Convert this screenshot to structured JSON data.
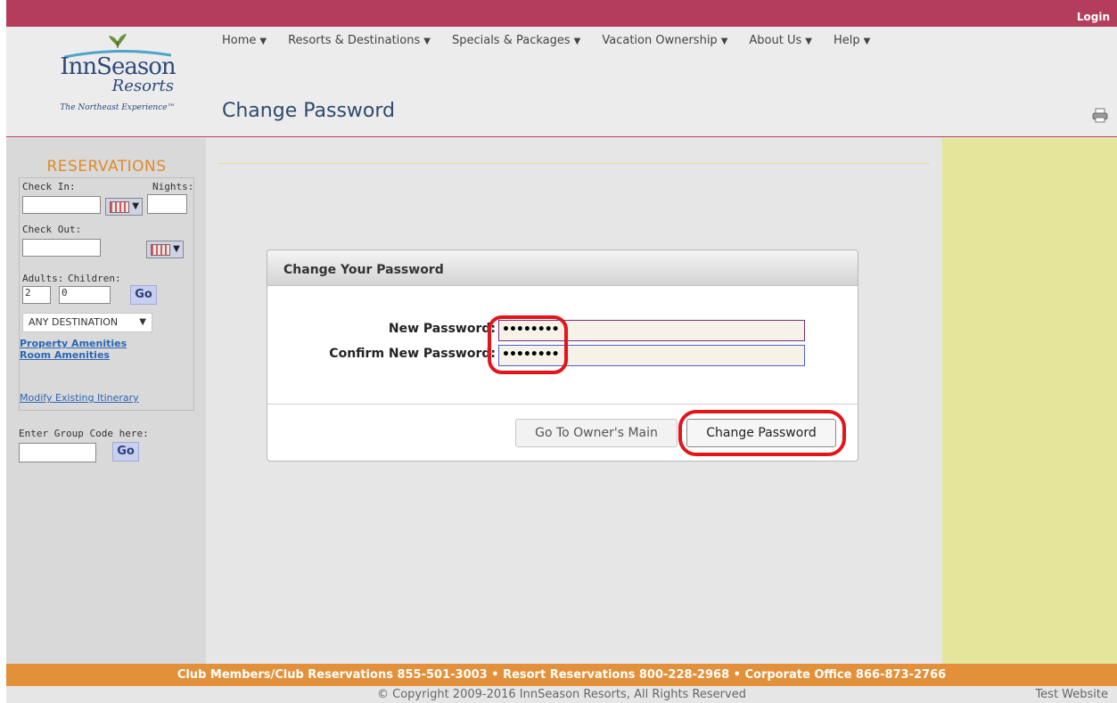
{
  "topbar": {
    "login_label": "Login"
  },
  "logo": {
    "name": "InnSeason",
    "sub": "Resorts",
    "tagline": "The Northeast Experience™"
  },
  "nav": [
    {
      "label": "Home"
    },
    {
      "label": "Resorts & Destinations"
    },
    {
      "label": "Specials & Packages"
    },
    {
      "label": "Vacation Ownership"
    },
    {
      "label": "About Us"
    },
    {
      "label": "Help"
    }
  ],
  "page": {
    "title": "Change Password"
  },
  "icons": {
    "printer": "printer-icon",
    "calendar": "calendar-icon",
    "caret": "chevron-down-icon"
  },
  "sidebar": {
    "title": "RESERVATIONS",
    "check_in_label": "Check In:",
    "nights_label": "Nights:",
    "check_out_label": "Check Out:",
    "adults_label": "Adults:",
    "children_label": "Children:",
    "adults_value": "2",
    "children_value": "0",
    "go_label": "Go",
    "destination_value": "ANY DESTINATION",
    "property_amenities": "Property Amenities",
    "room_amenities": "Room Amenities",
    "modify_itinerary": "Modify Existing Itinerary",
    "group_code_label": "Enter Group Code here:",
    "group_go_label": "Go"
  },
  "form": {
    "heading": "Change Your Password",
    "new_password_label": "New Password:",
    "new_password_value": "••••••••",
    "confirm_password_label": "Confirm New Password:",
    "confirm_password_value": "••••••••",
    "owner_main_label": "Go To Owner's Main",
    "change_password_label": "Change Password"
  },
  "footer": {
    "contacts": "Club Members/Club Reservations 855-501-3003 • Resort Reservations 800-228-2968 • Corporate Office 866-873-2766",
    "copyright": "© Copyright 2009-2016 InnSeason Resorts, All Rights Reserved",
    "test_site": "Test Website"
  },
  "colors": {
    "topbar": "#b53d5c",
    "footer_bar": "#e2913a",
    "right_panel": "#e5e59b",
    "reservations_title": "#e08a2a",
    "annotation": "#e3141a"
  }
}
